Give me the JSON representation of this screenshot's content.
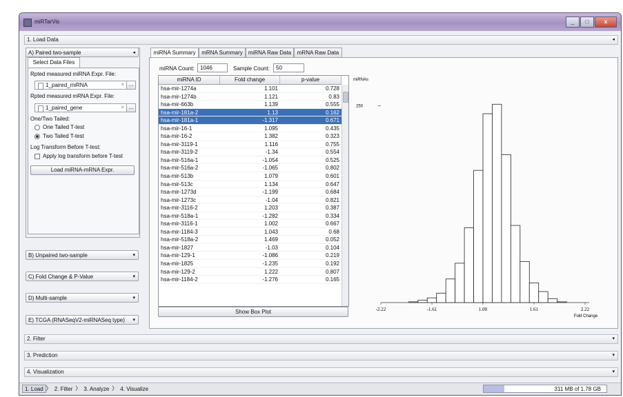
{
  "window": {
    "title": "miRTarVis"
  },
  "sections": {
    "load": "1. Load Data",
    "filter": "2. Filter",
    "prediction": "3. Prediction",
    "visualization": "4. Visualization"
  },
  "left": {
    "paired": "A) Paired two-sample",
    "select_tab": "Select Data Files",
    "mirna_label": "Rpted measured miRNA Expr. File:",
    "mirna_file": "1_paired_miRNA",
    "mrna_label": "Rpted measured mRNA Expr. File:",
    "mrna_file": "1_paired_gene",
    "browse": "...",
    "tail_label": "One/Two Tailed:",
    "one_tailed": "One Tailed T-test",
    "two_tailed": "Two Tailed T-test",
    "log_label": "Log Transform Before T-test:",
    "log_option": "Apply log transform before T-test",
    "load_button": "Load miRNA-mRNA Expr.",
    "unpaired": "B) Unpaired two-sample",
    "fold": "C) Fold Change & P-Value",
    "multi": "D) Multi-sample",
    "tcga": "E) TCGA (RNASeqV2-miRNASeq type)"
  },
  "tabs": [
    "miRNA Summary",
    "mRNA Summary",
    "miRNA Raw Data",
    "mRNA Raw Data"
  ],
  "summary": {
    "mirna_count_label": "miRNA Count:",
    "mirna_count": "1046",
    "sample_count_label": "Sample Count:",
    "sample_count": "50"
  },
  "table": {
    "columns": [
      "miRNA ID",
      "Fold change",
      "p-value"
    ],
    "rows": [
      [
        "hsa-mir-1274a",
        "1.101",
        "0.728"
      ],
      [
        "hsa-mir-1274b",
        "1.121",
        "0.83"
      ],
      [
        "hsa-mir-663b",
        "1.139",
        "0.555"
      ],
      [
        "hsa-mir-181a-2",
        "1.13",
        "0.162"
      ],
      [
        "hsa-mir-181a-1",
        "-1.317",
        "0.671"
      ],
      [
        "hsa-mir-16-1",
        "1.095",
        "0.435"
      ],
      [
        "hsa-mir-16-2",
        "1.382",
        "0.323"
      ],
      [
        "hsa-mir-3119-1",
        "1.116",
        "0.755"
      ],
      [
        "hsa-mir-3119-2",
        "-1.34",
        "0.554"
      ],
      [
        "hsa-mir-516a-1",
        "-1.054",
        "0.525"
      ],
      [
        "hsa-mir-516a-2",
        "-1.065",
        "0.802"
      ],
      [
        "hsa-mir-513b",
        "1.079",
        "0.601"
      ],
      [
        "hsa-mir-513c",
        "1.134",
        "0.647"
      ],
      [
        "hsa-mir-1273d",
        "-1.199",
        "0.684"
      ],
      [
        "hsa-mir-1273c",
        "-1.04",
        "0.821"
      ],
      [
        "hsa-mir-3116-2",
        "1.203",
        "0.387"
      ],
      [
        "hsa-mir-518a-1",
        "-1.282",
        "0.334"
      ],
      [
        "hsa-mir-3116-1",
        "1.002",
        "0.667"
      ],
      [
        "hsa-mir-1184-3",
        "1.043",
        "0.68"
      ],
      [
        "hsa-mir-518a-2",
        "1.469",
        "0.052"
      ],
      [
        "hsa-mir-1827",
        "-1.03",
        "0.104"
      ],
      [
        "hsa-mir-129-1",
        "-1.086",
        "0.219"
      ],
      [
        "hsa-mir-1825",
        "-1.235",
        "0.192"
      ],
      [
        "hsa-mir-129-2",
        "1.222",
        "0.807"
      ],
      [
        "hsa-mir-1184-2",
        "-1.276",
        "0.165"
      ]
    ],
    "selected": [
      3,
      4
    ],
    "box_plot_button": "Show Box Plot"
  },
  "chart_data": {
    "type": "bar",
    "ylabel": "miRNAs",
    "xlabel": "Fold Change",
    "y_ticks": [
      250
    ],
    "ylim": [
      0,
      275
    ],
    "x_ticks": [
      "-2.22",
      "-1.61",
      "1.00",
      "1.61",
      "2.22"
    ],
    "values": [
      0,
      0,
      0,
      1,
      3,
      6,
      12,
      30,
      50,
      95,
      168,
      240,
      252,
      188,
      98,
      52,
      25,
      14,
      5,
      1,
      0,
      0
    ]
  },
  "status": {
    "steps": [
      "1. Load",
      "2. Filter",
      "3. Analyze",
      "4. Visualize"
    ],
    "memory": "311 MB of 1.78 GB",
    "memory_fraction": 0.17
  }
}
